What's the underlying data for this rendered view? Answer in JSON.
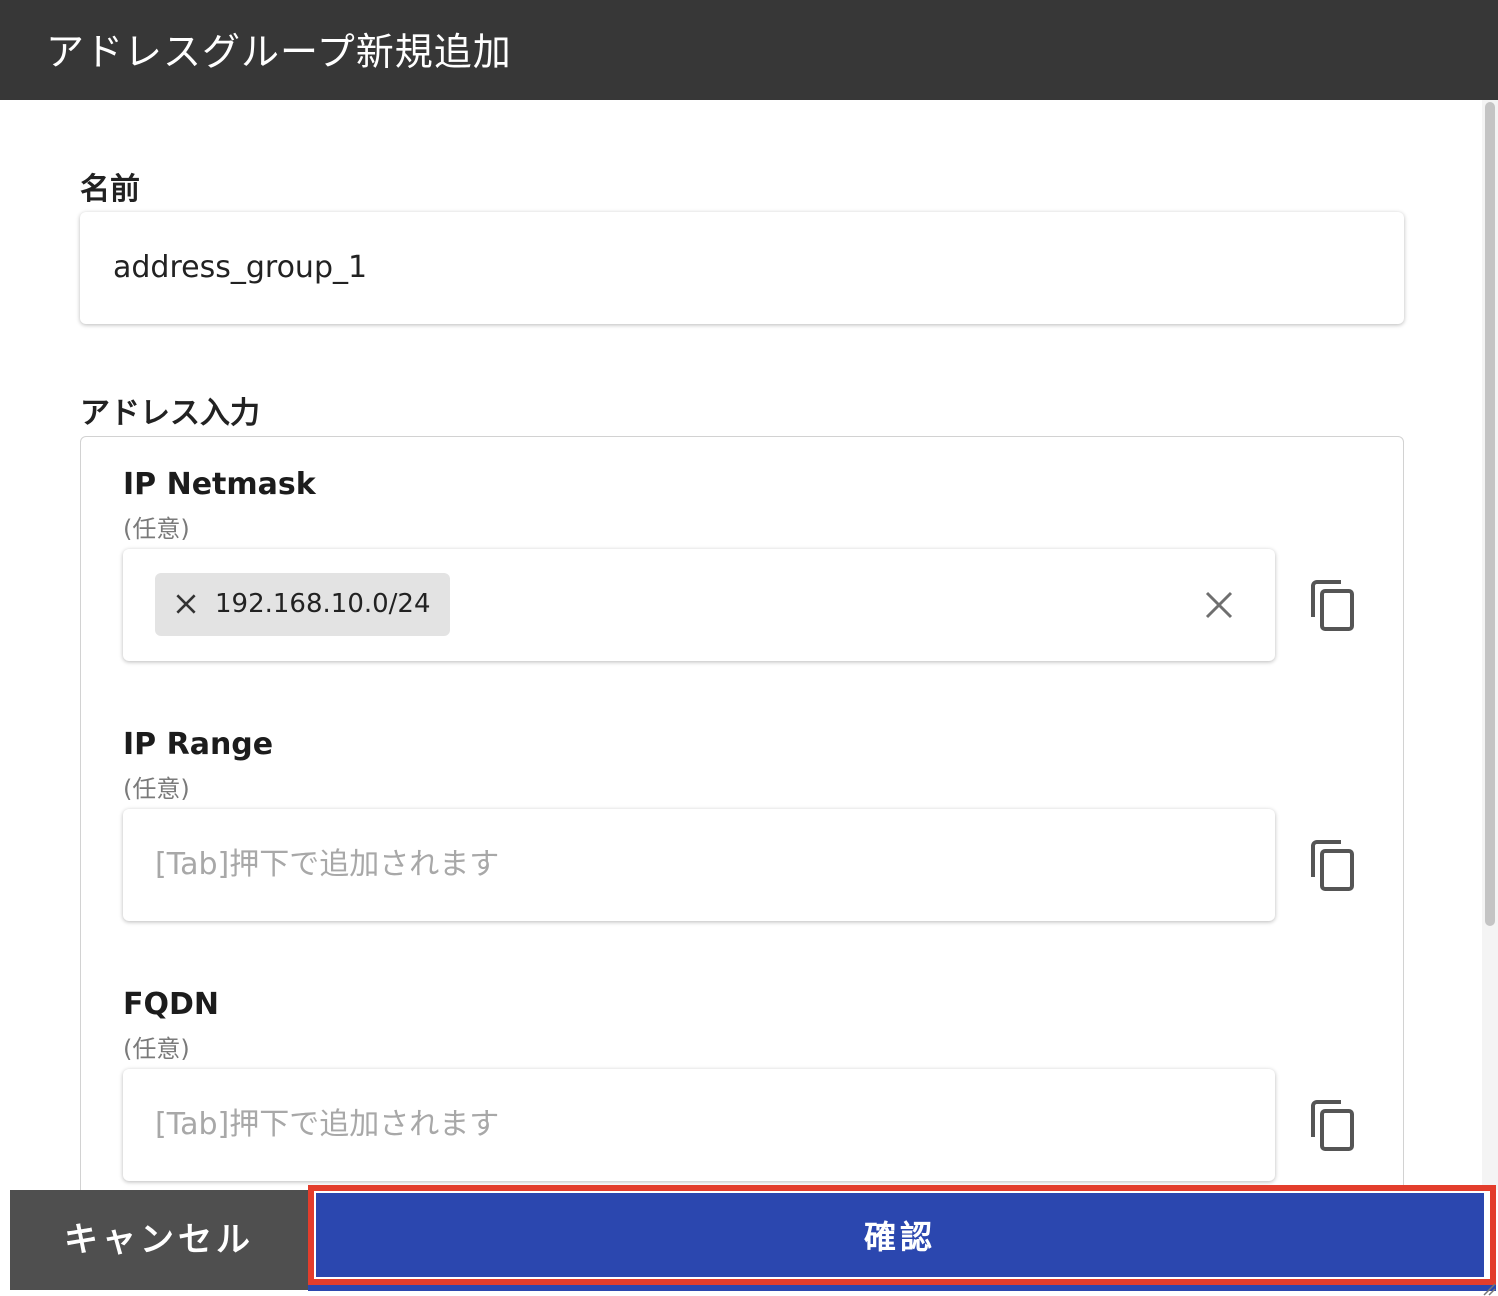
{
  "dialog": {
    "title": "アドレスグループ新規追加"
  },
  "name_section": {
    "label": "名前",
    "value": "address_group_1"
  },
  "address_section": {
    "label": "アドレス入力",
    "groups": [
      {
        "title": "IP Netmask",
        "optional_note": "(任意)",
        "chips": [
          "192.168.10.0/24"
        ],
        "placeholder": ""
      },
      {
        "title": "IP Range",
        "optional_note": "(任意)",
        "chips": [],
        "placeholder": "[Tab]押下で追加されます"
      },
      {
        "title": "FQDN",
        "optional_note": "(任意)",
        "chips": [],
        "placeholder": "[Tab]押下で追加されます"
      }
    ]
  },
  "footer": {
    "cancel_label": "キャンセル",
    "confirm_label": "確認"
  },
  "colors": {
    "header_bg": "#373737",
    "confirm_bg": "#2b47af",
    "cancel_bg": "#4f4f4f",
    "highlight_border": "#e33d2c"
  },
  "icons": {
    "chip_remove": "close-icon",
    "clear": "close-icon",
    "copy": "copy-icon"
  }
}
